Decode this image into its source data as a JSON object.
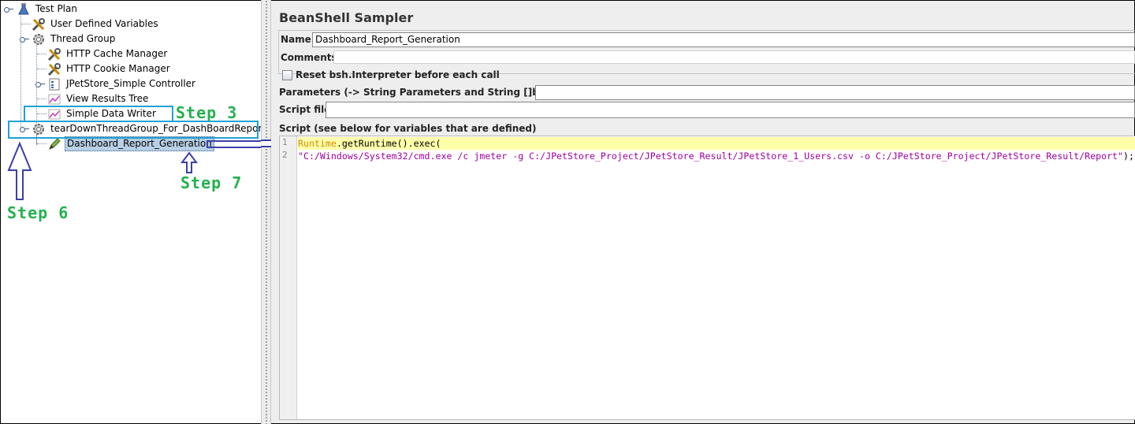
{
  "tree": {
    "nodes": [
      {
        "label": "Test Plan",
        "icon": "test-plan-flask-icon"
      },
      {
        "label": "User Defined Variables",
        "icon": "config-tools-icon"
      },
      {
        "label": "Thread Group",
        "icon": "thread-group-gear-icon"
      },
      {
        "label": "HTTP Cache Manager",
        "icon": "config-tools-icon"
      },
      {
        "label": "HTTP Cookie Manager",
        "icon": "config-tools-icon"
      },
      {
        "label": "JPetStore_Simple Controller",
        "icon": "controller-icon"
      },
      {
        "label": "View Results Tree",
        "icon": "listener-chart-icon"
      },
      {
        "label": "Simple Data Writer",
        "icon": "listener-chart-icon"
      },
      {
        "label": "tearDownThreadGroup_For_DashBoardReport",
        "icon": "thread-group-gear-icon"
      },
      {
        "label": "Dashboard_Report_Generation",
        "icon": "sampler-pen-icon"
      }
    ]
  },
  "annotations": {
    "step3": "Step 3",
    "step6": "Step 6",
    "step7": "Step 7",
    "color_box": "#1fa2d6",
    "color_text": "#23b14d",
    "color_arrow": "#3b3fa8"
  },
  "sampler": {
    "title": "BeanShell Sampler",
    "name_label": "Name:",
    "name_value": "Dashboard_Report_Generation",
    "comments_label": "Comments:",
    "reset_label": "Reset bsh.Interpreter before each call",
    "reset_checked": false,
    "parameters_label": "Parameters (-> String Parameters and String []bsh.args)",
    "script_file_label": "Script file",
    "script_label": "Script (see below for variables that are defined)"
  },
  "script": {
    "line_numbers": [
      "1",
      "2"
    ],
    "line1_class": "Runtime",
    "line1_rest": ".getRuntime().exec(",
    "line2_string": "\"C:/Windows/System32/cmd.exe /c jmeter -g C:/JPetStore_Project/JPetStore_Result/JPetStore_1_Users.csv -o C:/JPetStore_Project/JPetStore_Result/Report\"",
    "line2_end": ");"
  }
}
